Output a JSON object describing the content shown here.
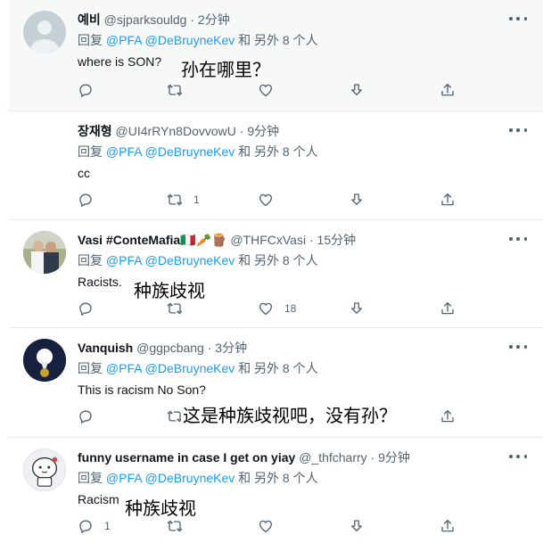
{
  "tweets": [
    {
      "name": "예비",
      "handle": "@sjparksouldg",
      "dot": "·",
      "time": "2分钟",
      "reply_prefix": "回复",
      "reply_mentions": "@PFA @DeBruyneKev",
      "reply_suffix": "和 另外 8 个人",
      "text": "where is SON?",
      "caption": "孙在哪里？",
      "reply_count": "",
      "retweet_count": "",
      "like_count": ""
    },
    {
      "name": "장재형",
      "handle": "@UI4rRYn8DovvowU",
      "dot": "·",
      "time": "9分钟",
      "reply_prefix": "回复",
      "reply_mentions": "@PFA @DeBruyneKev",
      "reply_suffix": "和 另外 8 个人",
      "text": "cc",
      "caption": "",
      "reply_count": "",
      "retweet_count": "1",
      "like_count": ""
    },
    {
      "name": "Vasi #ConteMafia🇮🇹🥕🪵",
      "handle": "@THFCxVasi",
      "dot": "·",
      "time": "15分钟",
      "reply_prefix": "回复",
      "reply_mentions": "@PFA @DeBruyneKev",
      "reply_suffix": "和 另外 8 个人",
      "text": "Racists.",
      "caption": "种族歧视",
      "reply_count": "",
      "retweet_count": "",
      "like_count": "18"
    },
    {
      "name": "Vanquish",
      "handle": "@ggpcbang",
      "dot": "·",
      "time": "3分钟",
      "reply_prefix": "回复",
      "reply_mentions": "@PFA @DeBruyneKev",
      "reply_suffix": "和 另外 8 个人",
      "text": "This is racism  No Son?",
      "caption": "这是种族歧视吧，没有孙？",
      "reply_count": "",
      "retweet_count": "",
      "like_count": ""
    },
    {
      "name": "funny username in case I get on yiay",
      "handle": "@_thfcharry",
      "dot": "·",
      "time": "9分钟",
      "reply_prefix": "回复",
      "reply_mentions": "@PFA @DeBruyneKev",
      "reply_suffix": "和 另外 8 个人",
      "text": "Racism",
      "caption": "种族歧视",
      "reply_count": "1",
      "retweet_count": "",
      "like_count": ""
    }
  ],
  "colors": {
    "link": "#1d9bf0",
    "muted": "#536471",
    "text": "#0f1419",
    "highlight_bg": "#f7f9f9"
  },
  "icons": [
    "reply-icon",
    "retweet-icon",
    "like-icon",
    "download-icon",
    "share-icon",
    "more-icon"
  ]
}
